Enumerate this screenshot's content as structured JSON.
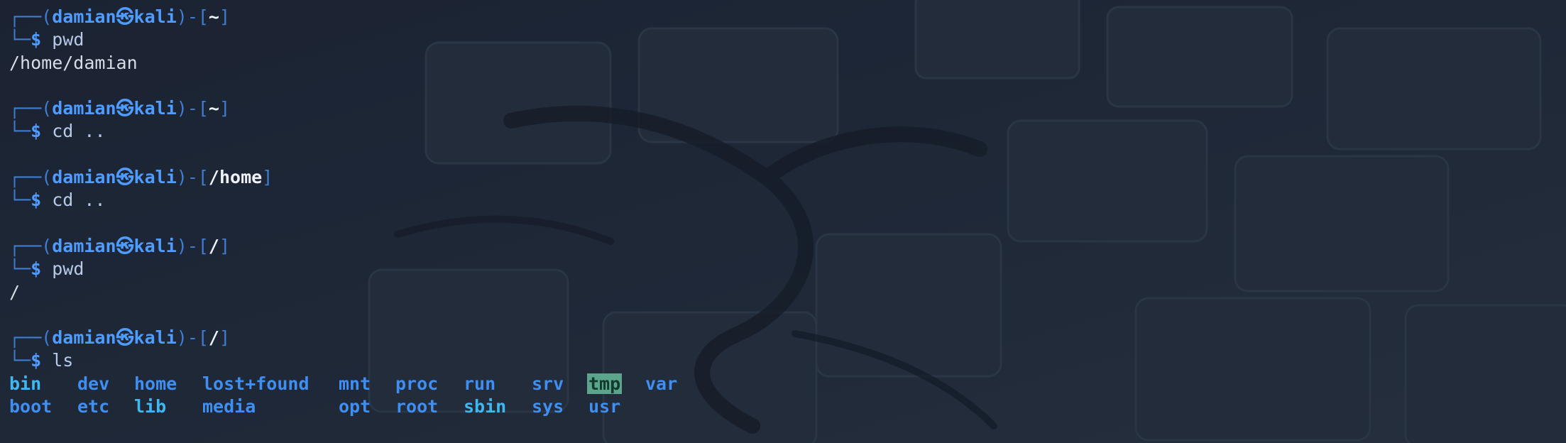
{
  "prompt": {
    "user": "damian",
    "host_symbol": "㉿",
    "host": "kali",
    "dollar": "$"
  },
  "blocks": [
    {
      "cwd": "~",
      "command": "pwd",
      "output": "/home/damian"
    },
    {
      "cwd": "~",
      "command": "cd ..",
      "output": ""
    },
    {
      "cwd": "/home",
      "command": "cd ..",
      "output": ""
    },
    {
      "cwd": "/",
      "command": "pwd",
      "output": "/"
    },
    {
      "cwd": "/",
      "command": "ls",
      "output": ""
    }
  ],
  "ls_rows": [
    [
      "bin",
      "dev",
      "home",
      "lost+found",
      "mnt",
      "proc",
      "run",
      "srv",
      "tmp",
      "var"
    ],
    [
      "boot",
      "etc",
      "lib",
      "media",
      "opt",
      "root",
      "sbin",
      "sys",
      "usr",
      ""
    ]
  ],
  "colors": {
    "background": "#1a2231",
    "prompt_frame": "#3f7dd2",
    "prompt_user": "#4f9cff",
    "directory": "#3f8ef0",
    "symlink": "#40b7ee",
    "sticky_dir_bg": "#5aa58c"
  }
}
